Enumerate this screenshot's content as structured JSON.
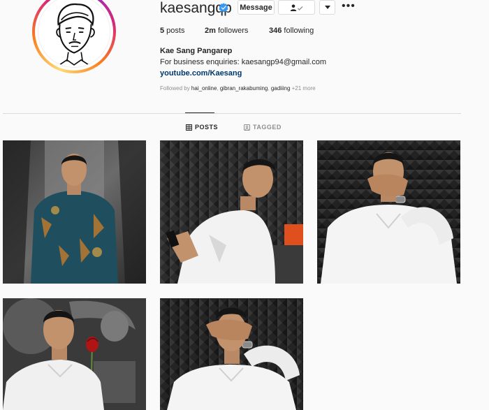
{
  "profile": {
    "username": "kaesangqp",
    "verified_icon": "verified-badge-icon",
    "display_name": "Kae Sang Pangarep",
    "bio": "For business enquiries: kaesangp94@gmail.com",
    "link": "youtube.com/Kaesang",
    "avatar_icon": "avatar-line-drawing"
  },
  "actions": {
    "message_label": "Message",
    "follow_icon": "person-check-icon",
    "more_icon": "chevron-down-icon",
    "options_icon": "more-horizontal-icon",
    "options_label": "•••"
  },
  "stats": {
    "posts_count": "5",
    "posts_label": " posts",
    "followers_count": "2m",
    "followers_label": " followers",
    "following_count": "346",
    "following_label": " following"
  },
  "followed_by": {
    "prefix": "Followed by ",
    "names": [
      "hai_online",
      "gibran_rakabuming",
      "gadiiing"
    ],
    "separator": ", ",
    "suffix": " +21 more"
  },
  "tabs": [
    {
      "label": "POSTS",
      "icon": "grid-icon",
      "active": true
    },
    {
      "label": "TAGGED",
      "icon": "tagged-icon",
      "active": false
    }
  ],
  "posts": [
    {
      "id": 1,
      "description": "man in batik shirt"
    },
    {
      "id": 2,
      "description": "man in white shirt with phone"
    },
    {
      "id": 3,
      "description": "man covering mouth"
    },
    {
      "id": 4,
      "description": "man holding rose"
    },
    {
      "id": 5,
      "description": "man covering eyes"
    }
  ],
  "colors": {
    "text": "#262626",
    "muted": "#8e8e8e",
    "link": "#00376b",
    "border": "#dbdbdb",
    "verified": "#3897f0",
    "background": "#fafafa"
  }
}
